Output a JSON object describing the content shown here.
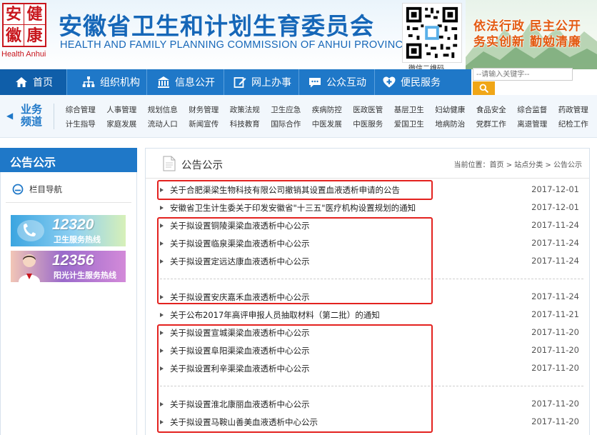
{
  "header": {
    "logo_chars": [
      "安",
      "健",
      "徽",
      "康"
    ],
    "logo_en": "Health Anhui",
    "title": "安徽省卫生和计划生育委员会",
    "title_en": "HEALTH AND FAMILY PLANNING COMMISSION OF ANHUI PROVINCE",
    "qr_label": "微信二维码",
    "slogan_line1": "依法行政  民主公开",
    "slogan_line2": "务实创新  勤勉清廉",
    "search_placeholder": "--请输入关键字--"
  },
  "nav": {
    "items": [
      {
        "label": "首页",
        "icon": "home-icon"
      },
      {
        "label": "组织机构",
        "icon": "org-chart-icon"
      },
      {
        "label": "信息公开",
        "icon": "building-icon"
      },
      {
        "label": "网上办事",
        "icon": "edit-icon"
      },
      {
        "label": "公众互动",
        "icon": "chat-icon"
      },
      {
        "label": "便民服务",
        "icon": "heart-plus-icon"
      }
    ]
  },
  "channels": {
    "title": "业务频道",
    "row1": [
      "综合管理",
      "人事管理",
      "规划信息",
      "财务管理",
      "政策法规",
      "卫生应急",
      "疾病防控",
      "医政医管",
      "基层卫生",
      "妇幼健康",
      "食品安全",
      "综合监督",
      "药政管理"
    ],
    "row2": [
      "计生指导",
      "家庭发展",
      "流动人口",
      "新闻宣传",
      "科技教育",
      "国际合作",
      "中医发展",
      "中医服务",
      "爱国卫生",
      "地病防治",
      "党群工作",
      "离退管理",
      "纪检工作"
    ]
  },
  "sidebar": {
    "title": "公告公示",
    "nav_label": "栏目导航",
    "hotlines": [
      {
        "number": "12320",
        "label": "卫生服务热线"
      },
      {
        "number": "12356",
        "label": "阳光计生服务热线"
      }
    ]
  },
  "main": {
    "title": "公告公示",
    "breadcrumb": "当前位置：首页 > 站点分类 > 公告公示",
    "news": [
      {
        "title": "关于合肥渠梁生物科技有限公司撤销其设置血液透析申请的公告",
        "date": "2017-12-01"
      },
      {
        "title": "安徽省卫生计生委关于印发安徽省\"十三五\"医疗机构设置规划的通知",
        "date": "2017-12-01"
      },
      {
        "title": "关于拟设置铜陵渠梁血液透析中心公示",
        "date": "2017-11-24"
      },
      {
        "title": "关于拟设置临泉渠梁血液透析中心公示",
        "date": "2017-11-24"
      },
      {
        "title": "关于拟设置定远达康血液透析中心公示",
        "date": "2017-11-24"
      },
      {
        "title": "关于拟设置安庆嘉禾血液透析中心公示",
        "date": "2017-11-24"
      },
      {
        "title": "关于公布2017年高评申报人员抽取材料（第二批）的通知",
        "date": "2017-11-21"
      },
      {
        "title": "关于拟设置宣城渠梁血液透析中心公示",
        "date": "2017-11-20"
      },
      {
        "title": "关于拟设置阜阳渠梁血液透析中心公示",
        "date": "2017-11-20"
      },
      {
        "title": "关于拟设置利辛渠梁血液透析中心公示",
        "date": "2017-11-20"
      },
      {
        "title": "关于拟设置淮北康丽血液透析中心公示",
        "date": "2017-11-20"
      },
      {
        "title": "关于拟设置马鞍山善美血液透析中心公示",
        "date": "2017-11-20"
      }
    ]
  },
  "colors": {
    "primary": "#1f78c8",
    "nav_active": "#0f5ea9",
    "logo_red": "#c8161d",
    "slogan_orange": "#e35a12",
    "highlight_red": "#e3221f",
    "search_button": "#f0a617"
  }
}
